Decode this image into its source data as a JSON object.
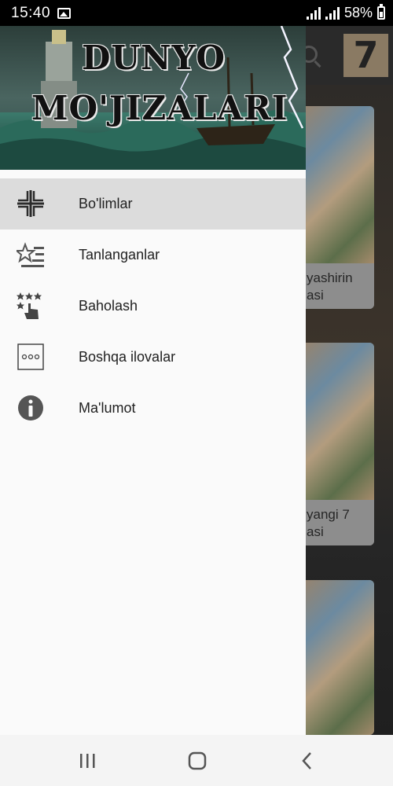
{
  "status_bar": {
    "time": "15:40",
    "battery": "58%",
    "icons": [
      "gallery-icon",
      "signal-icon",
      "signal-icon",
      "battery-icon"
    ]
  },
  "drawer": {
    "header": {
      "title_line1": "DUNYO",
      "title_line2": "MO'JIZALARI"
    },
    "items": [
      {
        "label": "Bo'limlar",
        "icon": "sections-icon",
        "active": true
      },
      {
        "label": "Tanlanganlar",
        "icon": "favorites-icon",
        "active": false
      },
      {
        "label": "Baholash",
        "icon": "rate-icon",
        "active": false
      },
      {
        "label": "Boshqa ilovalar",
        "icon": "more-apps-icon",
        "active": false
      },
      {
        "label": "Ma'lumot",
        "icon": "info-icon",
        "active": false
      }
    ]
  },
  "background": {
    "cards": [
      {
        "caption_line1": "yashirin",
        "caption_line2": "asi"
      },
      {
        "caption_line1": "yangi 7",
        "caption_line2": "asi"
      },
      {
        "caption_line1": "",
        "caption_line2": ""
      }
    ]
  },
  "nav_bar": {
    "buttons": [
      "recents-button",
      "home-button",
      "back-button"
    ]
  },
  "colors": {
    "drawer_bg": "#fafafa",
    "active_item_bg": "#dcdcdc",
    "status_bar_bg": "#000000",
    "nav_bar_bg": "#f4f4f4"
  }
}
